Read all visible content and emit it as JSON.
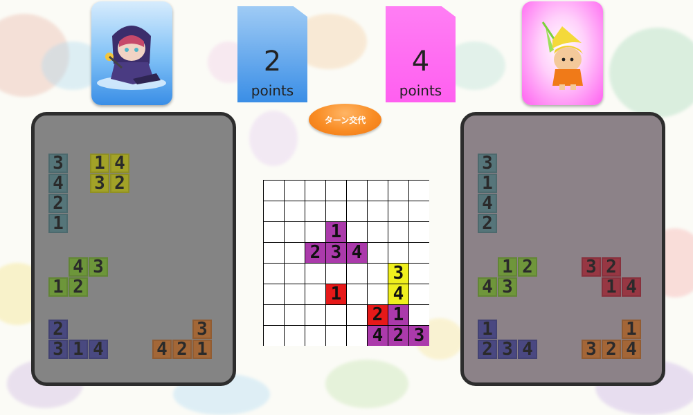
{
  "players": [
    {
      "score": "2",
      "points_label": "points",
      "avatar_icon": "hooded-ninja-icon",
      "card_color": "#3a8ee6",
      "hand_bg": "#848484"
    },
    {
      "score": "4",
      "points_label": "points",
      "avatar_icon": "leaf-sprite-icon",
      "card_color": "#ff5ff0",
      "hand_bg": "#8c8288"
    }
  ],
  "turn_button": {
    "label": "ターン交代"
  },
  "piece_colors": {
    "teal": "#4d7378",
    "olive": "#a8a817",
    "green": "#6a9a2e",
    "navy": "#3f3f80",
    "orange": "#a9622a",
    "crimson": "#9a2a38",
    "magenta": "#ab3aab",
    "red": "#e61919",
    "yellow": "#f0f01e"
  },
  "player1_pieces": [
    {
      "color": "teal",
      "cells": [
        {
          "c": 0,
          "r": 0,
          "n": "3"
        },
        {
          "c": 0,
          "r": 1,
          "n": "4"
        },
        {
          "c": 0,
          "r": 2,
          "n": "2"
        },
        {
          "c": 0,
          "r": 3,
          "n": "1"
        }
      ]
    },
    {
      "color": "olive",
      "cells": [
        {
          "c": 0,
          "r": 0,
          "n": "1"
        },
        {
          "c": 1,
          "r": 0,
          "n": "4"
        },
        {
          "c": 0,
          "r": 1,
          "n": "3"
        },
        {
          "c": 1,
          "r": 1,
          "n": "2"
        }
      ]
    },
    {
      "color": "green",
      "cells": [
        {
          "c": 1,
          "r": 0,
          "n": "4"
        },
        {
          "c": 2,
          "r": 0,
          "n": "3"
        },
        {
          "c": 0,
          "r": 1,
          "n": "1"
        },
        {
          "c": 1,
          "r": 1,
          "n": "2"
        }
      ]
    },
    {
      "color": "navy",
      "cells": [
        {
          "c": 0,
          "r": 0,
          "n": "2"
        },
        {
          "c": 0,
          "r": 1,
          "n": "3"
        },
        {
          "c": 1,
          "r": 1,
          "n": "1"
        },
        {
          "c": 2,
          "r": 1,
          "n": "4"
        }
      ]
    },
    {
      "color": "orange",
      "cells": [
        {
          "c": 2,
          "r": 0,
          "n": "3"
        },
        {
          "c": 0,
          "r": 1,
          "n": "4"
        },
        {
          "c": 1,
          "r": 1,
          "n": "2"
        },
        {
          "c": 2,
          "r": 1,
          "n": "1"
        }
      ]
    }
  ],
  "player2_pieces": [
    {
      "color": "teal",
      "cells": [
        {
          "c": 0,
          "r": 0,
          "n": "3"
        },
        {
          "c": 0,
          "r": 1,
          "n": "1"
        },
        {
          "c": 0,
          "r": 2,
          "n": "4"
        },
        {
          "c": 0,
          "r": 3,
          "n": "2"
        }
      ]
    },
    {
      "color": "green",
      "cells": [
        {
          "c": 1,
          "r": 0,
          "n": "1"
        },
        {
          "c": 2,
          "r": 0,
          "n": "2"
        },
        {
          "c": 0,
          "r": 1,
          "n": "4"
        },
        {
          "c": 1,
          "r": 1,
          "n": "3"
        }
      ]
    },
    {
      "color": "crimson",
      "cells": [
        {
          "c": 0,
          "r": 0,
          "n": "3"
        },
        {
          "c": 1,
          "r": 0,
          "n": "2"
        },
        {
          "c": 1,
          "r": 1,
          "n": "1"
        },
        {
          "c": 2,
          "r": 1,
          "n": "4"
        }
      ]
    },
    {
      "color": "navy",
      "cells": [
        {
          "c": 0,
          "r": 0,
          "n": "1"
        },
        {
          "c": 0,
          "r": 1,
          "n": "2"
        },
        {
          "c": 1,
          "r": 1,
          "n": "3"
        },
        {
          "c": 2,
          "r": 1,
          "n": "4"
        }
      ]
    },
    {
      "color": "orange",
      "cells": [
        {
          "c": 2,
          "r": 0,
          "n": "1"
        },
        {
          "c": 0,
          "r": 1,
          "n": "3"
        },
        {
          "c": 1,
          "r": 1,
          "n": "2"
        },
        {
          "c": 2,
          "r": 1,
          "n": "4"
        }
      ]
    }
  ],
  "board": {
    "size": 8,
    "tiles": [
      {
        "c": 3,
        "r": 2,
        "n": "1",
        "color": "magenta"
      },
      {
        "c": 2,
        "r": 3,
        "n": "2",
        "color": "magenta"
      },
      {
        "c": 3,
        "r": 3,
        "n": "3",
        "color": "magenta"
      },
      {
        "c": 4,
        "r": 3,
        "n": "4",
        "color": "magenta"
      },
      {
        "c": 6,
        "r": 4,
        "n": "3",
        "color": "yellow"
      },
      {
        "c": 6,
        "r": 5,
        "n": "4",
        "color": "yellow"
      },
      {
        "c": 3,
        "r": 5,
        "n": "1",
        "color": "red"
      },
      {
        "c": 5,
        "r": 6,
        "n": "2",
        "color": "red"
      },
      {
        "c": 6,
        "r": 6,
        "n": "1",
        "color": "magenta"
      },
      {
        "c": 5,
        "r": 7,
        "n": "4",
        "color": "magenta"
      },
      {
        "c": 6,
        "r": 7,
        "n": "2",
        "color": "magenta"
      },
      {
        "c": 7,
        "r": 7,
        "n": "3",
        "color": "magenta"
      }
    ]
  }
}
